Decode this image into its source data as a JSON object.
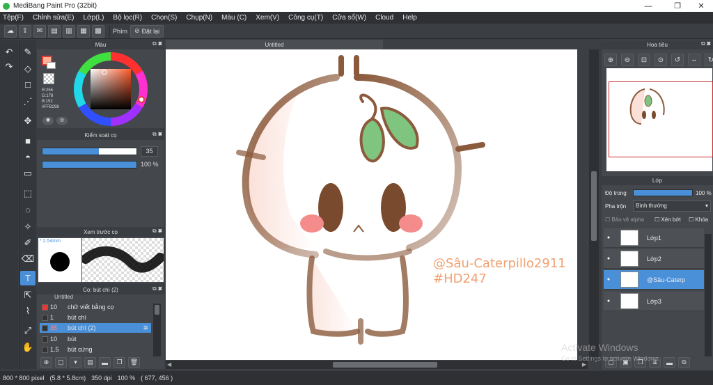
{
  "window": {
    "title": "MediBang Paint Pro (32bit)",
    "minimize": "—",
    "restore": "❐",
    "close": "✕"
  },
  "menu": [
    "Tệp(F)",
    "Chỉnh sửa(E)",
    "Lớp(L)",
    "Bộ lọc(R)",
    "Chọn(S)",
    "Chụp(N)",
    "Màu (C)",
    "Xem(V)",
    "Công cụ(T)",
    "Cửa sổ(W)",
    "Cloud",
    "Help"
  ],
  "toolbar": {
    "shortcut_label": "Phím",
    "reset_label": "Đặt lại"
  },
  "color_panel": {
    "title": "Màu",
    "r": "R:255",
    "g": "G:178",
    "b": "B:152",
    "hex": "#FFB298",
    "fg_color": "#FFB298"
  },
  "brush_control": {
    "title": "Kiểm soát cọ",
    "size_value": "35",
    "size_fraction": 0.6,
    "opacity_value": "100 %",
    "opacity_fraction": 1.0
  },
  "brush_preview": {
    "title": "Xem trước cọ",
    "size": "* 2.54mm"
  },
  "brush_list": {
    "title": "Cọ: bút chì (2)",
    "partial_top": "Untitled",
    "items": [
      {
        "size": "10",
        "name": "chữ viết bằng cọ",
        "color": "#e53935"
      },
      {
        "size": "1",
        "name": "bút chì",
        "color": "#333"
      },
      {
        "size": "35",
        "name": "bút chì (2)",
        "color": "#333",
        "selected": true
      },
      {
        "size": "10",
        "name": "bút",
        "color": "#333"
      },
      {
        "size": "1.5",
        "name": "bút cứng",
        "color": "#333"
      }
    ]
  },
  "canvas": {
    "tab_title": "Untitled",
    "signature_line1": "@Sâu-Caterpillo2911",
    "signature_line2": "#HD247"
  },
  "navigator": {
    "title": "Hoa tiêu"
  },
  "layers_panel": {
    "title": "Lớp",
    "opacity_label": "Độ trong",
    "opacity_value": "100 %",
    "opacity_fraction": 1.0,
    "blend_label": "Pha trộn",
    "blend_value": "Bình thường",
    "protect_alpha": "Bảo vệ alpha",
    "clipping": "Xén bớt",
    "lock": "Khóa",
    "layers": [
      {
        "name": "Lớp1",
        "selected": false
      },
      {
        "name": "Lớp2",
        "selected": false
      },
      {
        "name": "@Sâu-Caterp",
        "selected": true
      },
      {
        "name": "Lớp3",
        "selected": false
      }
    ]
  },
  "status": {
    "size": "800 * 800 pixel",
    "physical": "(5.8 * 5.8cm)",
    "dpi": "350 dpi",
    "zoom": "100 %",
    "coords": "( 677, 456 )"
  },
  "os_watermark": {
    "line1": "Activate Windows",
    "line2": "Go to Settings to activate Windows."
  }
}
